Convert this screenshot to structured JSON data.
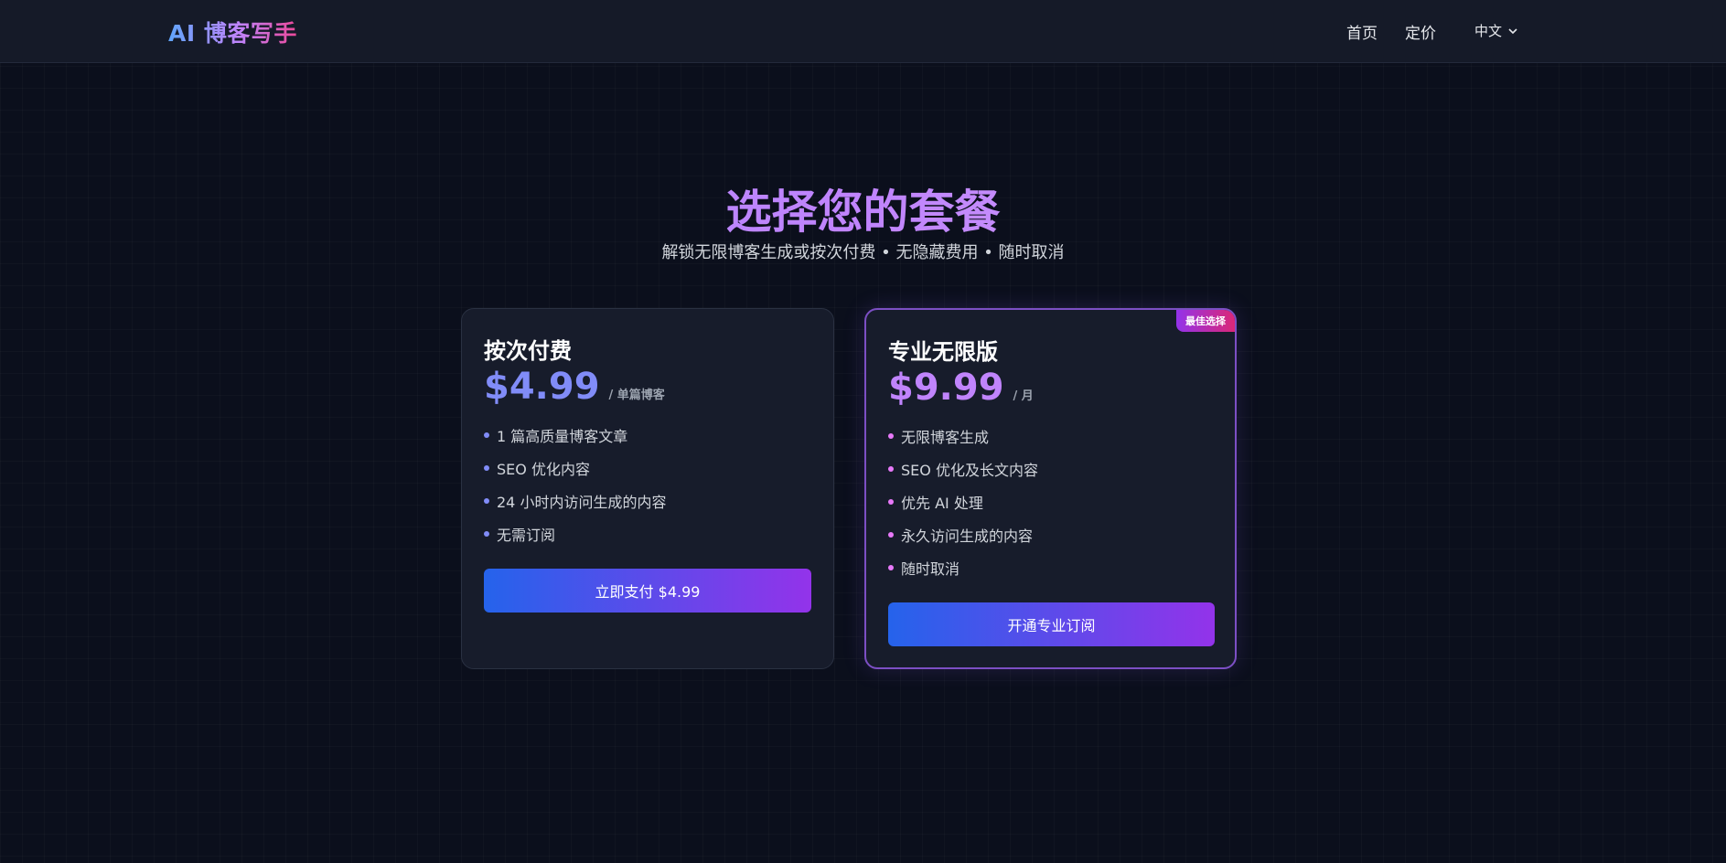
{
  "header": {
    "brand": "AI 博客写手",
    "nav": {
      "home": "首页",
      "pricing": "定价"
    },
    "language": "中文"
  },
  "hero": {
    "title": "选择您的套餐",
    "subtitle": "解锁无限博客生成或按次付费 • 无隐藏费用 • 随时取消"
  },
  "plans": [
    {
      "name": "按次付费",
      "price": "$4.99",
      "period": "/ 单篇博客",
      "features": [
        "1 篇高质量博客文章",
        "SEO 优化内容",
        "24 小时内访问生成的内容",
        "无需订阅"
      ],
      "cta": "立即支付 $4.99"
    },
    {
      "name": "专业无限版",
      "badge": "最佳选择",
      "price": "$9.99",
      "period": "/ 月",
      "features": [
        "无限博客生成",
        "SEO 优化及长文内容",
        "优先 AI 处理",
        "永久访问生成的内容",
        "随时取消"
      ],
      "cta": "开通专业订阅"
    }
  ],
  "colors": {
    "background": "#0b0f1c",
    "card": "#171c2b",
    "accent_blue": "#2563eb",
    "accent_purple": "#9333ea",
    "badge_pink": "#db2777"
  },
  "icons": {
    "language_dropdown": "chevron-down-icon",
    "feature_bullet": "dot-icon"
  }
}
